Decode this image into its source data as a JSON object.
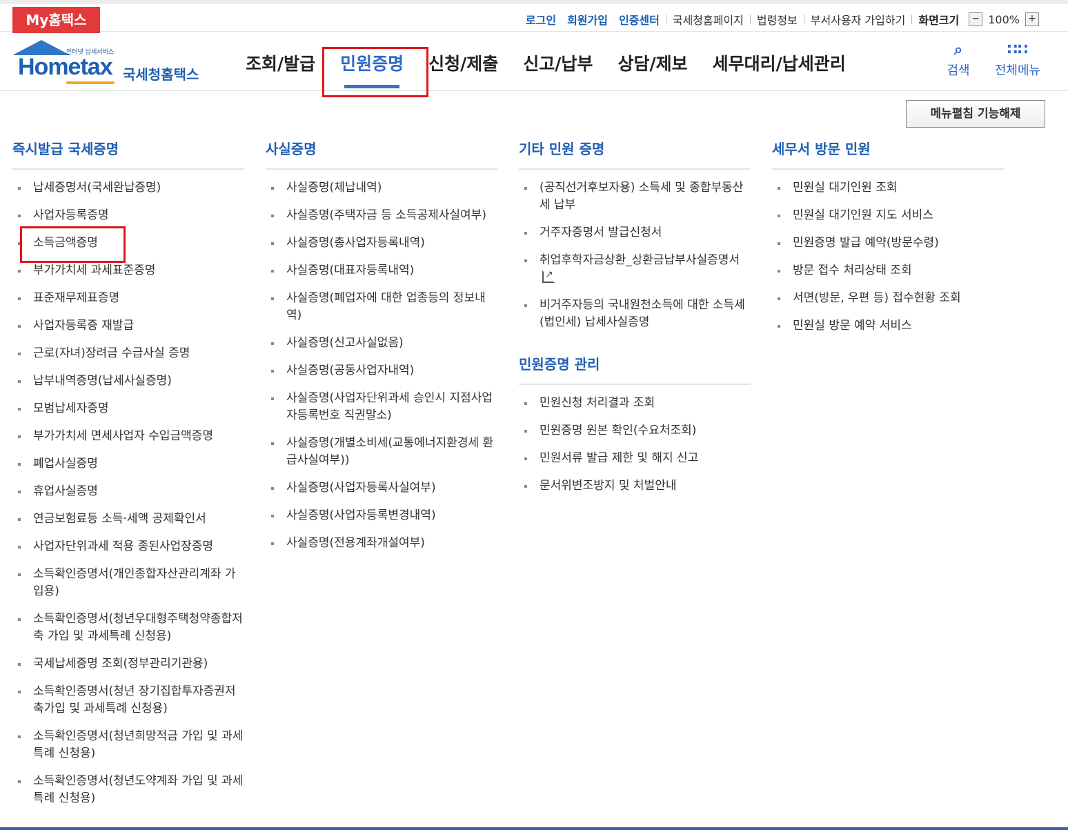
{
  "topbar": {
    "my_hometax": "My홈택스",
    "login": "로그인",
    "signup": "회원가입",
    "cert_center": "인증센터",
    "nts_home": "국세청홈페이지",
    "law_info": "법령정보",
    "dept_user_signup": "부서사용자 가입하기",
    "screen_size": "화면크기",
    "zoom_minus": "−",
    "zoom_value": "100%",
    "zoom_plus": "+"
  },
  "logo": {
    "sub": "인터넷 납세서비스",
    "main": "Hometax",
    "kr": "국세청홈택스"
  },
  "gnb": {
    "items": [
      "조회/발급",
      "민원증명",
      "신청/제출",
      "신고/납부",
      "상담/제보",
      "세무대리/납세관리"
    ],
    "active_index": 1
  },
  "tools": {
    "search": "검색",
    "all_menu": "전체메뉴"
  },
  "fold_button": "메뉴펼침 기능해제",
  "columns": {
    "instant": {
      "title": "즉시발급 국세증명",
      "items": [
        "납세증명서(국세완납증명)",
        "사업자등록증명",
        "소득금액증명",
        "부가가치세 과세표준증명",
        "표준재무제표증명",
        "사업자등록증 재발급",
        "근로(자녀)장려금 수급사실 증명",
        "납부내역증명(납세사실증명)",
        "모범납세자증명",
        "부가가치세 면세사업자 수입금액증명",
        "폐업사실증명",
        "휴업사실증명",
        "연금보험료등 소득·세액 공제확인서",
        "사업자단위과세 적용 종된사업장증명",
        "소득확인증명서(개인종합자산관리계좌 가입용)",
        "소득확인증명서(청년우대형주택청약종합저축 가입 및 과세특례 신청용)",
        "국세납세증명 조회(정부관리기관용)",
        "소득확인증명서(청년 장기집합투자증권저축가입 및 과세특례 신청용)",
        "소득확인증명서(청년희망적금 가입 및 과세특례 신청용)",
        "소득확인증명서(청년도약계좌 가입 및 과세특례 신청용)"
      ]
    },
    "fact": {
      "title": "사실증명",
      "items": [
        "사실증명(체납내역)",
        "사실증명(주택자금 등 소득공제사실여부)",
        "사실증명(총사업자등록내역)",
        "사실증명(대표자등록내역)",
        "사실증명(폐업자에 대한 업종등의 정보내역)",
        "사실증명(신고사실없음)",
        "사실증명(공동사업자내역)",
        "사실증명(사업자단위과세 승인시 지점사업자등록번호 직권말소)",
        "사실증명(개별소비세(교통에너지환경세 환급사실여부))",
        "사실증명(사업자등록사실여부)",
        "사실증명(사업자등록변경내역)",
        "사실증명(전용계좌개설여부)"
      ]
    },
    "other": {
      "title": "기타 민원 증명",
      "items": [
        "(공직선거후보자용) 소득세 및 종합부동산세 납부",
        "거주자증명서 발급신청서",
        "취업후학자금상환_상환금납부사실증명서",
        "비거주자등의 국내원천소득에 대한 소득세(법인세) 납세사실증명"
      ]
    },
    "manage": {
      "title": "민원증명 관리",
      "items": [
        "민원신청 처리결과 조회",
        "민원증명 원본 확인(수요처조회)",
        "민원서류 발급 제한 및 해지 신고",
        "문서위변조방지 및 처벌안내"
      ]
    },
    "visit": {
      "title": "세무서 방문 민원",
      "items": [
        "민원실 대기인원 조회",
        "민원실 대기인원 지도 서비스",
        "민원증명 발급 예약(방문수령)",
        "방문 접수 처리상태 조회",
        "서면(방문, 우편 등) 접수현황 조회",
        "민원실 방문 예약 서비스"
      ]
    }
  },
  "colors": {
    "accent": "#2e68c6",
    "highlight_box": "#e0161c",
    "my_hometax_bg": "#e23a3a"
  }
}
